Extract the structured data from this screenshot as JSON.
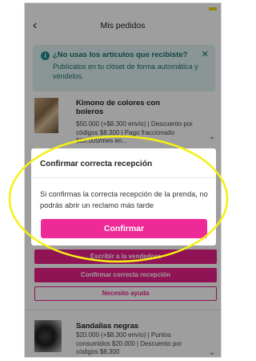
{
  "header": {
    "title": "Mis pedidos",
    "back_icon": "chevron-left-icon"
  },
  "banner": {
    "title": "¿No usas los artículos que recibiste?",
    "body": "Publícalos en tu clóset de forma automática y véndelos.",
    "close_label": "✕"
  },
  "orders": [
    {
      "name": "Kimono de colores con boleros",
      "details": "$50.000 (+$8.300 envío) | Descuento por códigos $8.300 | Pago fraccionado $10.000/mes en..."
    },
    {
      "name": "Sandalias negras",
      "details": "$20.000 (+$8.300 envío) | Puntos consumidos $20.000 | Descuento por códigos $8.300"
    }
  ],
  "actions": {
    "write_seller": "Escribir a la vendedora",
    "confirm_receipt": "Confirmar correcta recepción",
    "need_help": "Necesito ayuda"
  },
  "modal": {
    "title": "Confirmar correcta recepción",
    "body": "Si confirmas la correcta recepción de la prenda, no podrás abrir un reclamo más tarde",
    "button": "Confirmar"
  },
  "colors": {
    "accent": "#e81f8c",
    "banner_bg": "#dff3f2",
    "annotation": "#f5f011"
  }
}
